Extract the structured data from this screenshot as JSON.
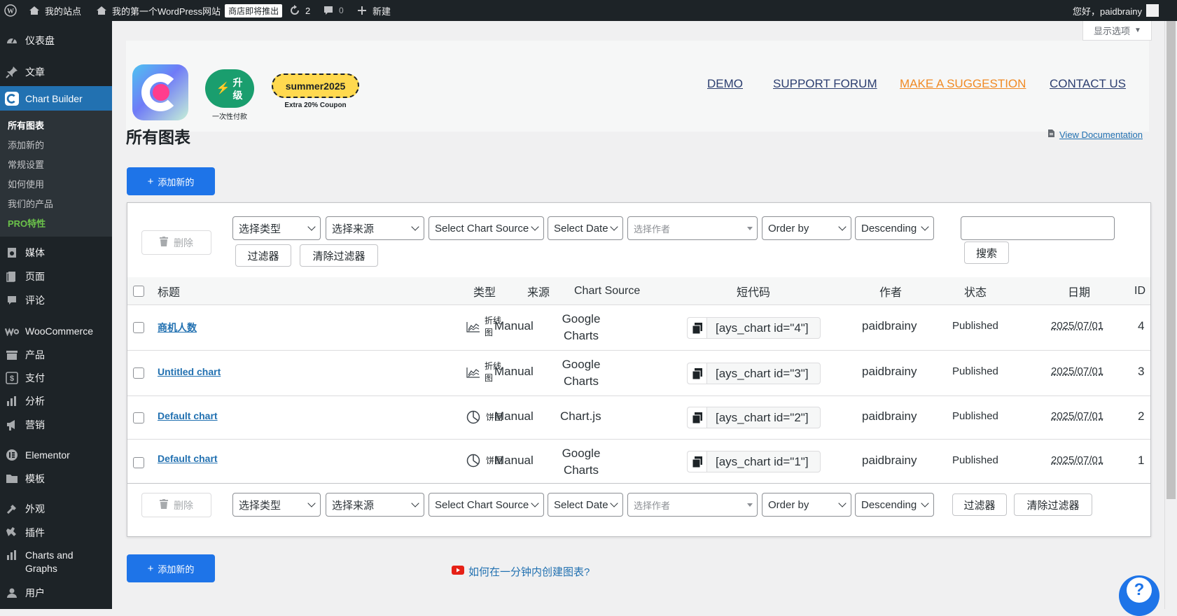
{
  "adminbar": {
    "site_label": "我的站点",
    "site_name": "我的第一个WordPress网站",
    "store_badge": "商店即将推出",
    "updates_count": "2",
    "comments_count": "0",
    "new_label": "新建",
    "greeting": "您好，paidbrainy"
  },
  "sidebar": {
    "items": [
      {
        "label": "仪表盘",
        "icon": "dashboard-icon"
      },
      {
        "label": "文章",
        "icon": "pin-icon"
      },
      {
        "label": "Chart Builder",
        "icon": "chart-builder-icon"
      },
      {
        "label": "媒体",
        "icon": "media-icon"
      },
      {
        "label": "页面",
        "icon": "page-icon"
      },
      {
        "label": "评论",
        "icon": "comment-icon"
      },
      {
        "label": "WooCommerce",
        "icon": "woocommerce-icon"
      },
      {
        "label": "产品",
        "icon": "product-icon"
      },
      {
        "label": "支付",
        "icon": "payment-icon"
      },
      {
        "label": "分析",
        "icon": "analytics-icon"
      },
      {
        "label": "营销",
        "icon": "marketing-icon"
      },
      {
        "label": "Elementor",
        "icon": "elementor-icon"
      },
      {
        "label": "模板",
        "icon": "template-icon"
      },
      {
        "label": "外观",
        "icon": "appearance-icon"
      },
      {
        "label": "插件",
        "icon": "plugin-icon"
      },
      {
        "label": "Charts and Graphs",
        "icon": "charts-graphs-icon"
      },
      {
        "label": "用户",
        "icon": "users-icon"
      }
    ],
    "submenu": [
      {
        "label": "所有图表"
      },
      {
        "label": "添加新的"
      },
      {
        "label": "常规设置"
      },
      {
        "label": "如何使用"
      },
      {
        "label": "我们的产品"
      },
      {
        "label": "PRO特性"
      }
    ]
  },
  "screen_options": "显示选项",
  "promo": {
    "upgrade_label": "升级",
    "upgrade_sub": "一次性付款",
    "coupon_code": "summer2025",
    "coupon_sub": "Extra 20% Coupon",
    "links": [
      "DEMO",
      "SUPPORT FORUM",
      "MAKE A SUGGESTION",
      "CONTACT US"
    ]
  },
  "page_title": "所有图表",
  "doc_link": "View Documentation",
  "add_new_label": "添加新的",
  "filters": {
    "delete_label": "删除",
    "type": "选择类型",
    "source": "选择来源",
    "chart_source": "Select Chart Source",
    "date": "Select Date",
    "author_placeholder": "选择作者",
    "order_by": "Order by",
    "direction": "Descending",
    "filter_btn": "过滤器",
    "clear_btn": "清除过滤器",
    "search_btn": "搜索",
    "search_value": ""
  },
  "table": {
    "headers": [
      "标题",
      "类型",
      "来源",
      "Chart Source",
      "短代码",
      "作者",
      "状态",
      "日期",
      "ID"
    ],
    "rows": [
      {
        "title": "商机人数",
        "type": "折线图",
        "type_icon": "line-chart-icon",
        "source": "Manual",
        "chart_source": "Google Charts",
        "shortcode": "[ays_chart id=\"4\"]",
        "author": "paidbrainy",
        "status": "Published",
        "date": "2025/07/01",
        "id": "4"
      },
      {
        "title": "Untitled chart",
        "type": "折线图",
        "type_icon": "line-chart-icon",
        "source": "Manual",
        "chart_source": "Google Charts",
        "shortcode": "[ays_chart id=\"3\"]",
        "author": "paidbrainy",
        "status": "Published",
        "date": "2025/07/01",
        "id": "3"
      },
      {
        "title": "Default chart",
        "type": "饼图",
        "type_icon": "pie-chart-icon",
        "source": "Manual",
        "chart_source": "Chart.js",
        "shortcode": "[ays_chart id=\"2\"]",
        "author": "paidbrainy",
        "status": "Published",
        "date": "2025/07/01",
        "id": "2"
      },
      {
        "title": "Default chart",
        "type": "饼图",
        "type_icon": "pie-chart-icon",
        "source": "Manual",
        "chart_source": "Google Charts",
        "shortcode": "[ays_chart id=\"1\"]",
        "author": "paidbrainy",
        "status": "Published",
        "date": "2025/07/01",
        "id": "1"
      }
    ]
  },
  "tutorial_link": "如何在一分钟内创建图表?",
  "colors": {
    "primary": "#1e74e8",
    "link": "#2271b1",
    "suggestion": "#f08a24",
    "upgrade": "#1a9e6e",
    "coupon": "#ffd94f"
  }
}
